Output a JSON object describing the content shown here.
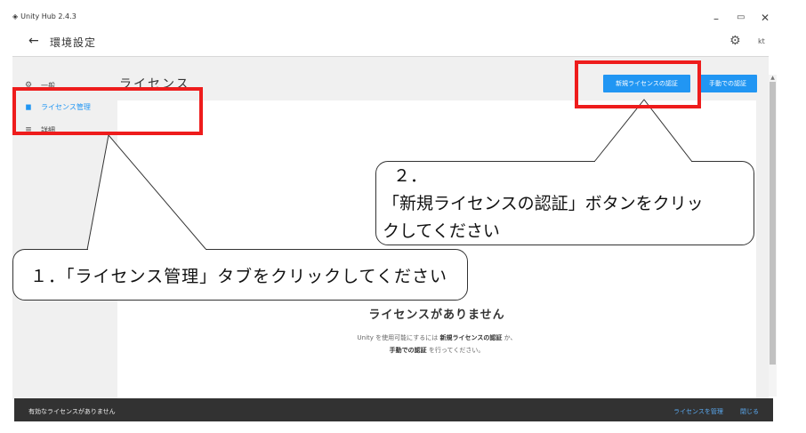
{
  "window": {
    "app_title": "Unity Hub 2.4.3",
    "logo_glyph": "◈",
    "minimize_glyph": "–",
    "maximize_glyph": "▭",
    "close_glyph": "✕"
  },
  "header": {
    "back_glyph": "←",
    "title": "環境設定",
    "gear_glyph": "⚙",
    "user_initials": "kt"
  },
  "sidebar": {
    "items": [
      {
        "label": "一般",
        "icon": "gear-icon",
        "glyph": "⚙"
      },
      {
        "label": "ライセンス管理",
        "icon": "license-icon",
        "glyph": "▆",
        "active": true
      },
      {
        "label": "詳細",
        "icon": "advanced-icon",
        "glyph": "≡"
      }
    ]
  },
  "main": {
    "section_title": "ライセンス",
    "new_license_button": "新規ライセンスの認証",
    "manual_button": "手動での認証",
    "empty_title": "ライセンスがありません",
    "empty_desc_1_a": "Unity を使用可能にするには",
    "empty_desc_1_b": "新規ライセンスの認証",
    "empty_desc_1_c": "か、",
    "empty_desc_2_a": "手動での認証",
    "empty_desc_2_b": "を行ってください。"
  },
  "bottom_bar": {
    "message": "有効なライセンスがありません",
    "manage_link": "ライセンスを管理",
    "close_link": "閉じる"
  },
  "annotations": {
    "callout_1": "１．「ライセンス管理」タブをクリックしてください",
    "callout_2_num": "２．",
    "callout_2_line1": "「新規ライセンスの認証」ボタンをクリッ",
    "callout_2_line2": "クしてください"
  },
  "colors": {
    "accent": "#2196f3",
    "annotation_red": "#ee1c1c",
    "bottom_bar": "#323232"
  }
}
